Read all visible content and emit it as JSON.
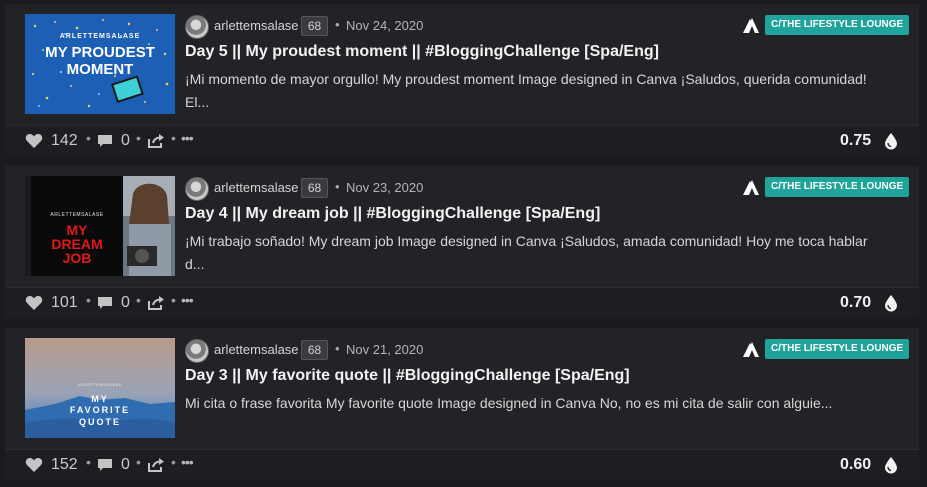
{
  "posts": [
    {
      "author": "arlettemsalase",
      "reputation": "68",
      "date": "Nov 24, 2020",
      "community": "C/THE LIFESTYLE LOUNGE",
      "title": "Day 5 || My proudest moment || #BloggingChallenge [Spa/Eng]",
      "summary": "¡Mi momento de mayor orgullo! My proudest moment Image designed in Canva ¡Saludos, querida comunidad! El...",
      "votes": "142",
      "comments": "0",
      "payout": "0.75",
      "thumb": {
        "handle": "ARLETTEMSALASE",
        "line1": "MY PROUDEST",
        "line2": "MOMENT"
      }
    },
    {
      "author": "arlettemsalase",
      "reputation": "68",
      "date": "Nov 23, 2020",
      "community": "C/THE LIFESTYLE LOUNGE",
      "title": "Day 4 || My dream job || #BloggingChallenge [Spa/Eng]",
      "summary": "¡Mi trabajo soñado! My dream job Image designed in Canva ¡Saludos, amada comunidad! Hoy me toca hablar d...",
      "votes": "101",
      "comments": "0",
      "payout": "0.70",
      "thumb": {
        "handle": "ARLETTEMSALASE",
        "line1": "MY",
        "line2": "DREAM",
        "line3": "JOB"
      }
    },
    {
      "author": "arlettemsalase",
      "reputation": "68",
      "date": "Nov 21, 2020",
      "community": "C/THE LIFESTYLE LOUNGE",
      "title": "Day 3 || My favorite quote || #BloggingChallenge [Spa/Eng]",
      "summary": "Mi cita o frase favorita My favorite quote Image designed in Canva No, no es mi cita de salir con alguie...",
      "votes": "152",
      "comments": "0",
      "payout": "0.60",
      "thumb": {
        "handle": "ARLETTEMSALASE",
        "line1": "MY",
        "line2": "FAVORITE",
        "line3": "QUOTE"
      }
    }
  ],
  "icons": {
    "vote": "heart-icon",
    "comment": "comment-icon",
    "reblog": "reblog-icon",
    "more": "more-icon",
    "payout": "droplet-icon",
    "community_logo": "hive-logo-icon"
  },
  "colors": {
    "background": "#1a1b1e",
    "card": "#222326",
    "community_badge": "#1fa39a"
  }
}
